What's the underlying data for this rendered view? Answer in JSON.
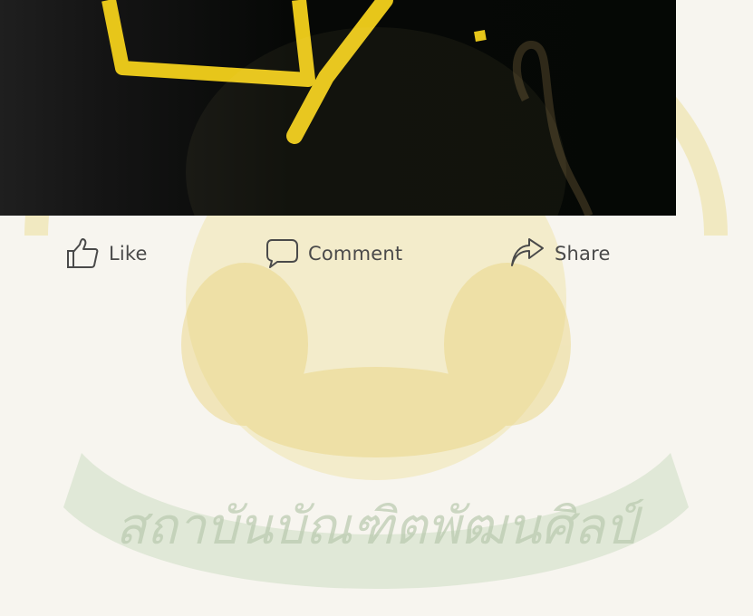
{
  "watermark_text": "สถาบันบัณฑิตพัฒนศิลป์",
  "colors": {
    "background": "#f7f5ef",
    "watermark": "#e8d58a",
    "photo_dark": "#060806",
    "photo_yellow": "#e7c61a",
    "action_text": "#4a4a4a"
  },
  "actions": {
    "like": {
      "label": "Like",
      "icon": "thumbs-up-icon"
    },
    "comment": {
      "label": "Comment",
      "icon": "speech-bubble-icon"
    },
    "share": {
      "label": "Share",
      "icon": "share-arrow-icon"
    }
  }
}
